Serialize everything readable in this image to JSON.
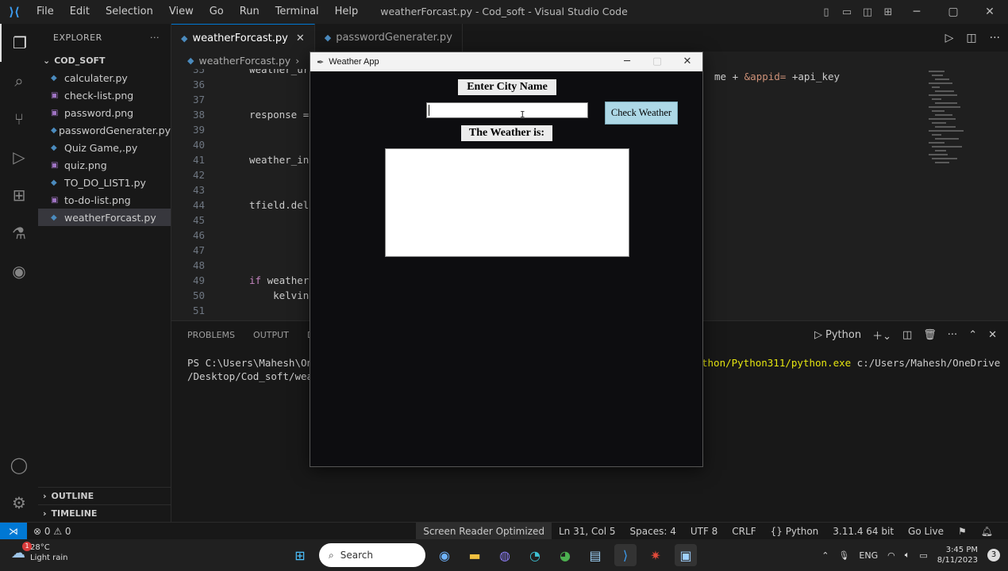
{
  "titlebar": {
    "menus": [
      "File",
      "Edit",
      "Selection",
      "View",
      "Go",
      "Run",
      "Terminal",
      "Help"
    ],
    "window_title": "weatherForcast.py - Cod_soft - Visual Studio Code"
  },
  "sidebar": {
    "title": "EXPLORER",
    "more": "···",
    "folder": "COD_SOFT",
    "files": [
      {
        "name": "calculater.py",
        "type": "py"
      },
      {
        "name": "check-list.png",
        "type": "png"
      },
      {
        "name": "password.png",
        "type": "png"
      },
      {
        "name": "passwordGenerater.py",
        "type": "py"
      },
      {
        "name": "Quiz Game,.py",
        "type": "py"
      },
      {
        "name": "quiz.png",
        "type": "png"
      },
      {
        "name": "TO_DO_LIST1.py",
        "type": "py"
      },
      {
        "name": "to-do-list.png",
        "type": "png"
      },
      {
        "name": "weatherForcast.py",
        "type": "py",
        "selected": true
      }
    ],
    "outline": "OUTLINE",
    "timeline": "TIMELINE"
  },
  "editor": {
    "tabs": [
      {
        "label": "weatherForcast.py",
        "active": true
      },
      {
        "label": "passwordGenerater.py",
        "active": false
      }
    ],
    "breadcrumb": "weatherForcast.py",
    "lines": [
      {
        "n": "35",
        "code": "weather_ur"
      },
      {
        "n": "36",
        "code": ""
      },
      {
        "n": "37",
        "code": ""
      },
      {
        "n": "38",
        "code": "response ="
      },
      {
        "n": "39",
        "code": ""
      },
      {
        "n": "40",
        "code": ""
      },
      {
        "n": "41",
        "code": "weather_in"
      },
      {
        "n": "42",
        "code": ""
      },
      {
        "n": "43",
        "code": ""
      },
      {
        "n": "44",
        "code": "tfield.del"
      },
      {
        "n": "45",
        "code": ""
      },
      {
        "n": "46",
        "code": ""
      },
      {
        "n": "47",
        "code": ""
      },
      {
        "n": "48",
        "code": ""
      },
      {
        "n": "49",
        "code": "if weather"
      },
      {
        "n": "50",
        "code": "    kelvin"
      },
      {
        "n": "51",
        "code": ""
      }
    ],
    "right_code_a": "me + ",
    "right_code_b": "&appid=",
    "right_code_c": " +api_key"
  },
  "panel": {
    "tabs": [
      "PROBLEMS",
      "OUTPUT",
      "DE"
    ],
    "terminal_label": "Python",
    "term_left_1": "PS C:\\Users\\Mahesh\\On",
    "term_left_2": "/Desktop/Cod_soft/wea",
    "term_right_yellow": "thon/Python311/python.exe",
    "term_right_rest": " c:/Users/Mahesh/OneDrive"
  },
  "statusbar": {
    "problems": "⊗ 0 ⚠ 0",
    "items": [
      "Screen Reader Optimized",
      "Ln 31, Col 5",
      "Spaces: 4",
      "UTF 8",
      "CRLF",
      "{} Python",
      "3.11.4 64 bit",
      "Go Live"
    ]
  },
  "taskbar": {
    "temp": "28°C",
    "condition": "Light rain",
    "badge": "1",
    "search_placeholder": "Search",
    "lang": "ENG",
    "time": "3:45 PM",
    "date": "8/11/2023",
    "notif_count": "3"
  },
  "weather_app": {
    "title": "Weather App",
    "enter_label": "Enter City Name",
    "city_value": "",
    "button_label": "Check Weather",
    "result_label": "The Weather is:",
    "result_text": ""
  }
}
